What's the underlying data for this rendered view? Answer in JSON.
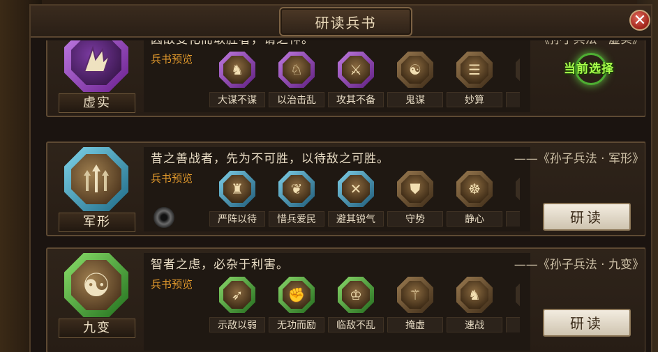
{
  "window": {
    "title": "研读兵书",
    "close_symbol": "✕"
  },
  "colors": {
    "purple": "#8b3db8",
    "blue": "#3fa8c8",
    "green": "#3fbf3a",
    "accent_orange": "#e39a2c",
    "current_select_green": "#a9ff4c"
  },
  "preview_label": "兵书预览",
  "study_label": "研读",
  "current_select_label": "当前选择",
  "books": [
    {
      "name": "虚实",
      "quote": "因敌变化而取胜者，谓之神。",
      "source": "——《孙子兵法 · 虚实》",
      "emblem": "banner-icon",
      "skills": [
        "大谋不谋",
        "以治击乱",
        "攻其不备",
        "鬼谋",
        "妙算"
      ],
      "status": "current"
    },
    {
      "name": "军形",
      "quote": "昔之善战者，先为不可胜，以待敌之可胜。",
      "source": "——《孙子兵法 · 军形》",
      "emblem": "arrows-icon",
      "skills": [
        "严阵以待",
        "惜兵爱民",
        "避其锐气",
        "守势",
        "静心"
      ],
      "status": "available"
    },
    {
      "name": "九变",
      "quote": "智者之虑，必杂于利害。",
      "source": "——《孙子兵法 · 九变》",
      "emblem": "yin-yang-icon",
      "skills": [
        "示敌以弱",
        "无功而励",
        "临敌不乱",
        "掩虚",
        "速战"
      ],
      "status": "available"
    }
  ]
}
